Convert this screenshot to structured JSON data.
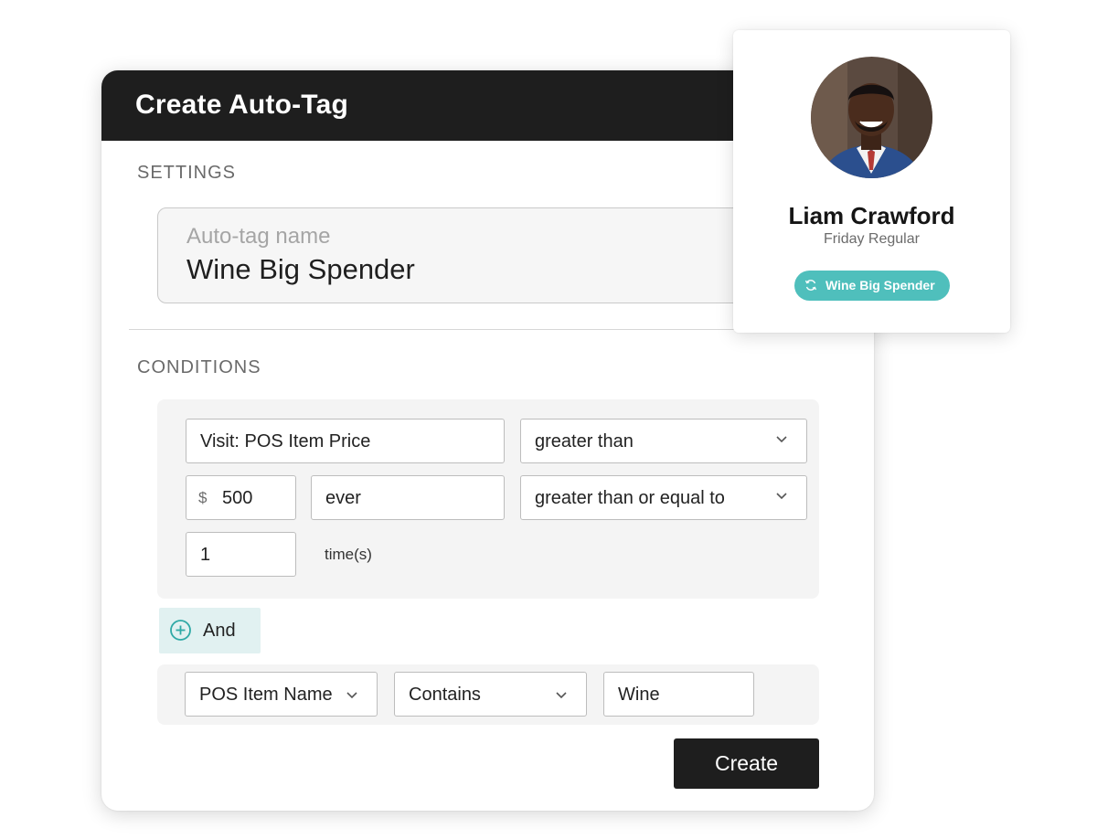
{
  "modal": {
    "title": "Create Auto-Tag",
    "settings_heading": "SETTINGS",
    "name_field": {
      "label": "Auto-tag name",
      "value": "Wine Big Spender"
    },
    "conditions_heading": "CONDITIONS",
    "condition_group_1": {
      "attribute": "Visit: POS Item Price",
      "operator": "greater than",
      "currency_symbol": "$",
      "amount": "500",
      "timeframe": "ever",
      "count_operator": "greater than or equal to",
      "count": "1",
      "count_unit": "time(s)"
    },
    "and_button_label": "And",
    "condition_group_2": {
      "attribute": "POS Item Name",
      "operator": "Contains",
      "value": "Wine"
    },
    "create_button_label": "Create"
  },
  "profile_card": {
    "name": "Liam Crawford",
    "subtitle": "Friday Regular",
    "tag_label": "Wine Big Spender",
    "tag_color": "#4fbfbc"
  },
  "colors": {
    "header_bg": "#1e1e1e",
    "accent_teal": "#4fbfbc",
    "and_button_bg": "#e1f1f1",
    "panel_bg": "#f4f4f4"
  },
  "icons": {
    "dropdown": "chevron-down-icon",
    "add_condition": "plus-circle-icon",
    "tag": "sync-icon"
  }
}
